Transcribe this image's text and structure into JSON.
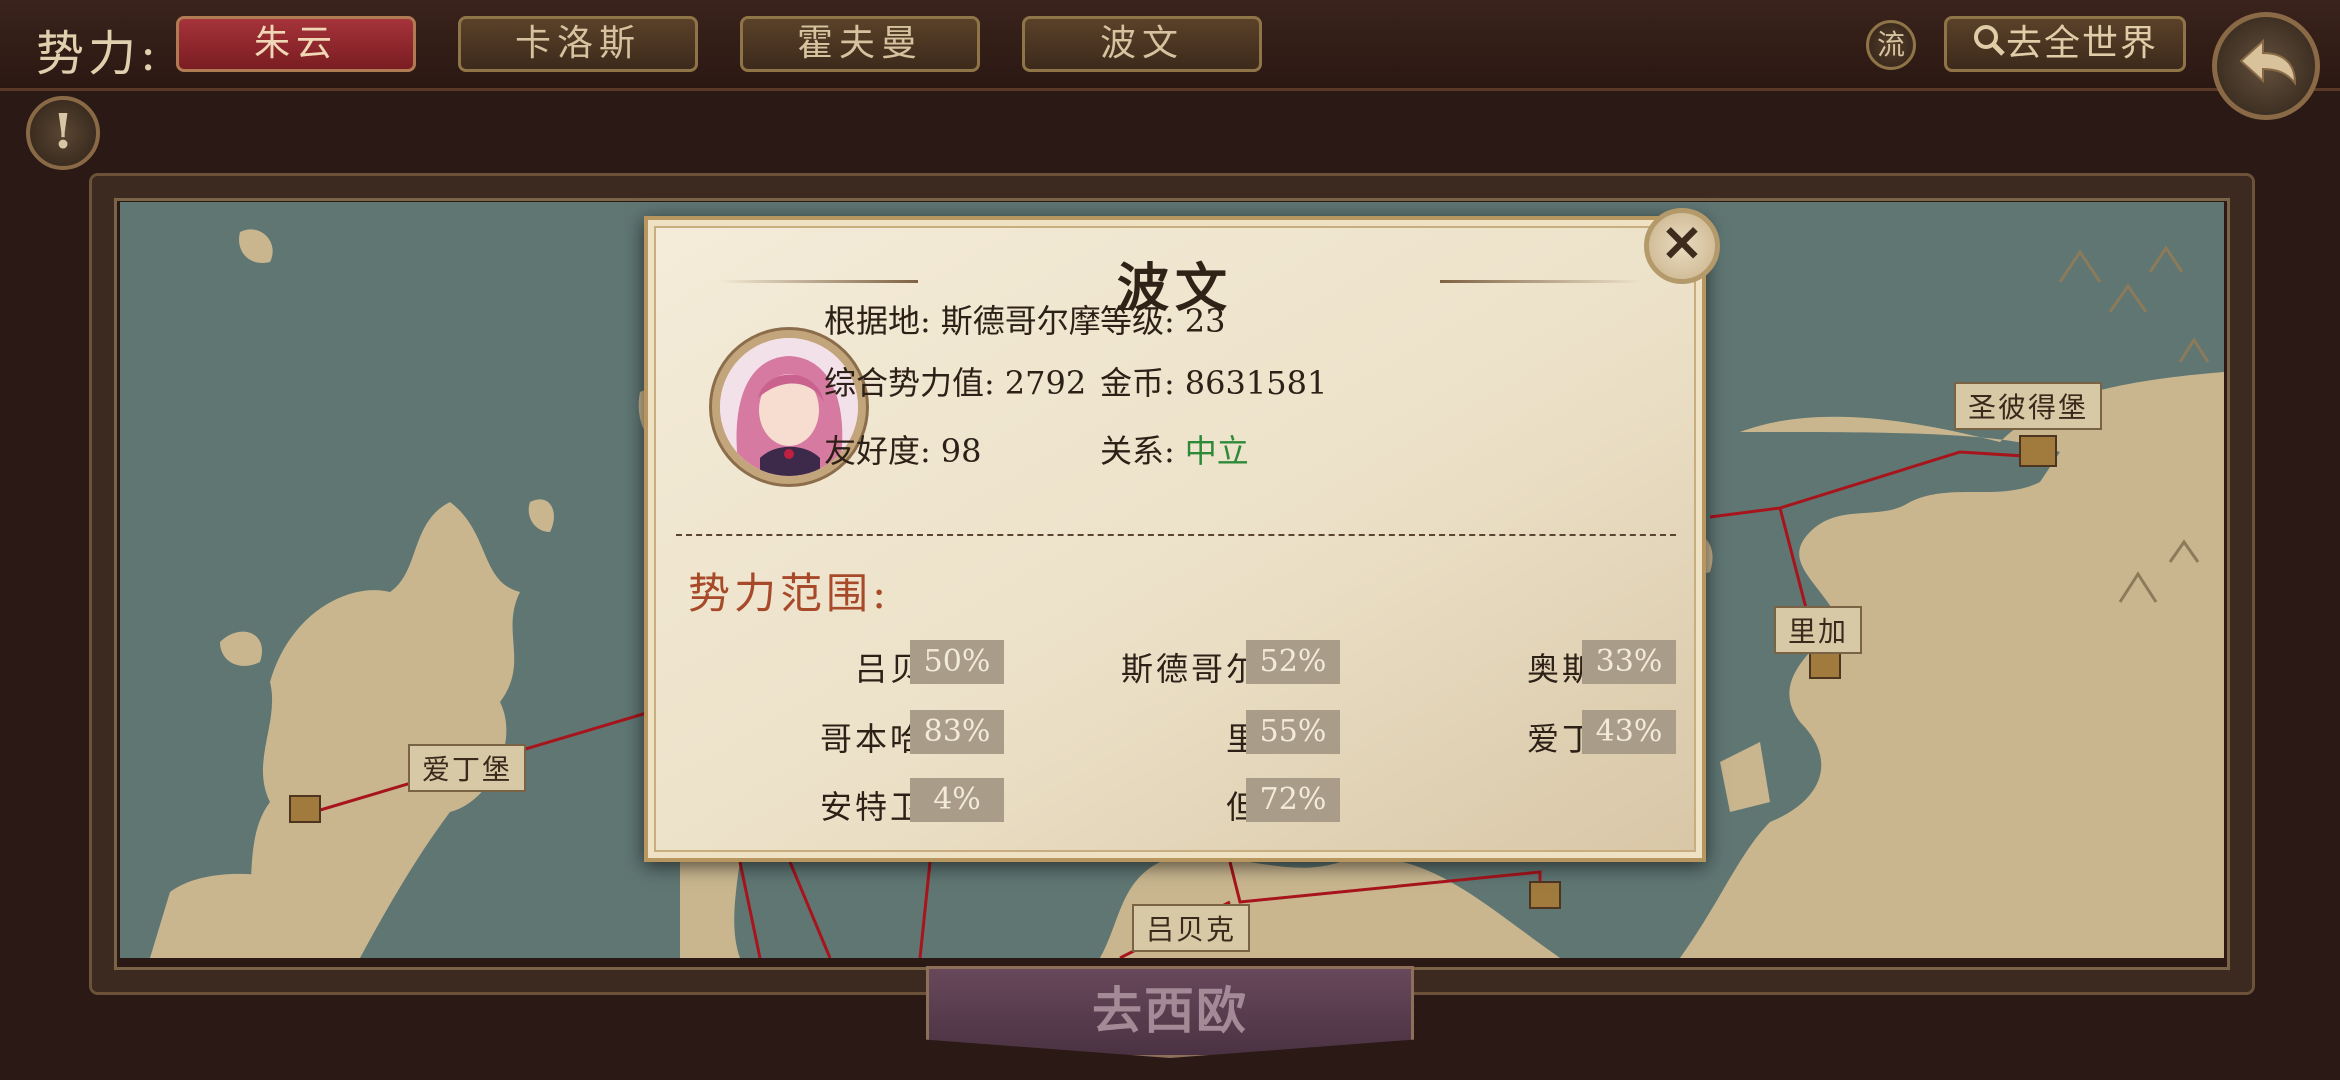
{
  "topbar": {
    "label": "势力:",
    "factions": [
      "朱云",
      "卡洛斯",
      "霍夫曼",
      "波文"
    ],
    "active_faction": "朱云",
    "flow_button": "流",
    "go_world": "去全世界"
  },
  "map": {
    "places": [
      "爱丁堡",
      "圣彼得堡",
      "里加",
      "吕贝克"
    ],
    "go_region": "去西欧"
  },
  "panel": {
    "title": "波文",
    "base_label": "根据地:",
    "base_value": "斯德哥尔摩",
    "level_label": "等级:",
    "level_value": "23",
    "power_label": "综合势力值:",
    "power_value": "2792",
    "gold_label": "金币:",
    "gold_value": "8631581",
    "friend_label": "友好度:",
    "friend_value": "98",
    "relation_label": "关系:",
    "relation_value": "中立",
    "relation_color": "#2c8a38",
    "section_title": "势力范围:",
    "regions": [
      {
        "name": "吕贝克",
        "pct": "50%"
      },
      {
        "name": "斯德哥尔摩",
        "pct": "52%"
      },
      {
        "name": "奥斯陆",
        "pct": "33%"
      },
      {
        "name": "哥本哈根",
        "pct": "83%"
      },
      {
        "name": "里加",
        "pct": "55%"
      },
      {
        "name": "爱丁堡",
        "pct": "43%"
      },
      {
        "name": "安特卫普",
        "pct": "4%"
      },
      {
        "name": "但泽",
        "pct": "72%"
      }
    ]
  }
}
